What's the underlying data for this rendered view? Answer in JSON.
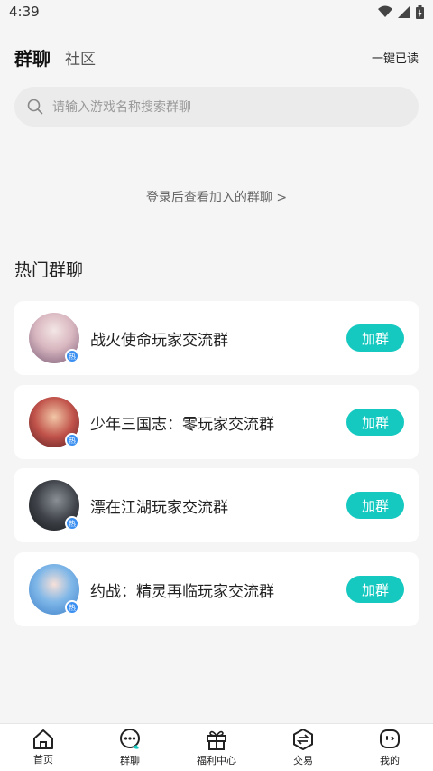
{
  "status_bar": {
    "time": "4:39",
    "wifi_icon": "wifi-icon",
    "signal_icon": "signal-icon",
    "battery_icon": "battery-icon"
  },
  "header": {
    "tab_active": "群聊",
    "tab_other": "社区",
    "mark_all_read": "一键已读"
  },
  "search": {
    "placeholder": "请输入游戏名称搜索群聊",
    "icon": "search-icon"
  },
  "login_tip": "登录后查看加入的群聊 >",
  "hot_section": {
    "title": "热门群聊",
    "groups": [
      {
        "name": "战火使命玩家交流群",
        "button": "加群",
        "badge": "热"
      },
      {
        "name": "少年三国志：零玩家交流群",
        "button": "加群",
        "badge": "热"
      },
      {
        "name": "漂在江湖玩家交流群",
        "button": "加群",
        "badge": "热"
      },
      {
        "name": "约战：精灵再临玩家交流群",
        "button": "加群",
        "badge": "热"
      }
    ]
  },
  "bottom_nav": [
    {
      "label": "首页",
      "icon": "home-icon"
    },
    {
      "label": "群聊",
      "icon": "chat-icon"
    },
    {
      "label": "福利中心",
      "icon": "gift-icon"
    },
    {
      "label": "交易",
      "icon": "exchange-icon"
    },
    {
      "label": "我的",
      "icon": "profile-icon"
    }
  ],
  "colors": {
    "accent": "#15c9c0",
    "badge": "#3a8ff0",
    "background": "#f5f5f5"
  }
}
